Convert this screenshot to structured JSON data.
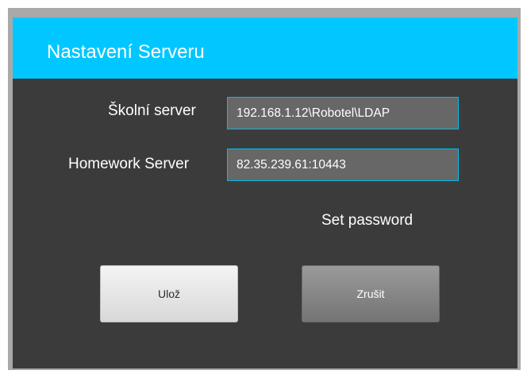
{
  "dialog": {
    "title": "Nastavení Serveru",
    "fields": [
      {
        "label": "Školní server",
        "value": "192.168.1.12\\Robotel\\LDAP"
      },
      {
        "label": "Homework Server",
        "value": "82.35.239.61:10443"
      }
    ],
    "set_password_label": "Set password",
    "save_label": "Ulož",
    "cancel_label": "Zrušit"
  },
  "colors": {
    "title_bar": "#00c7ff",
    "dialog_background": "#3b3b3b",
    "input_background": "#676767",
    "input_border": "#00bde8"
  }
}
